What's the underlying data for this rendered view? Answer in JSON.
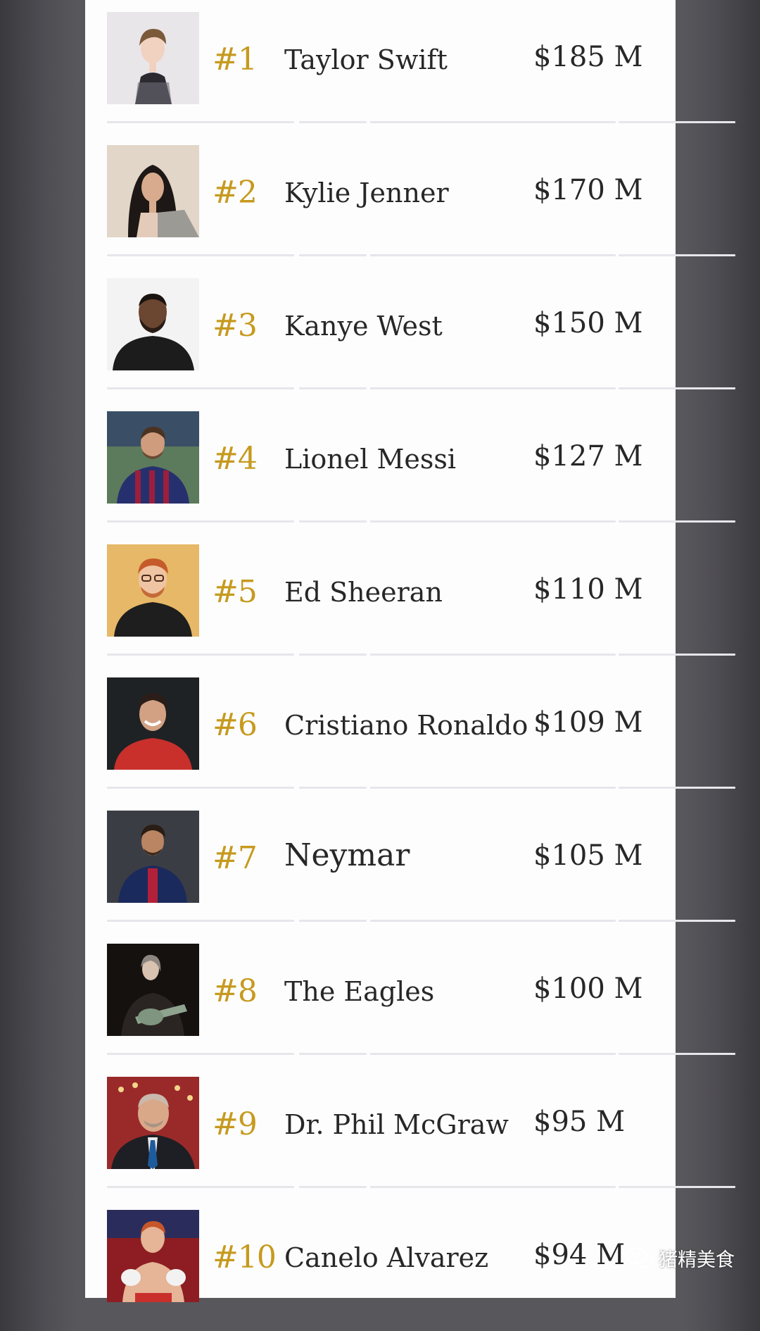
{
  "list": {
    "items": [
      {
        "rank": "#1",
        "name": "Taylor Swift",
        "amount": "$185 M"
      },
      {
        "rank": "#2",
        "name": "Kylie Jenner",
        "amount": "$170 M"
      },
      {
        "rank": "#3",
        "name": "Kanye West",
        "amount": "$150 M"
      },
      {
        "rank": "#4",
        "name": "Lionel Messi",
        "amount": "$127 M"
      },
      {
        "rank": "#5",
        "name": "Ed Sheeran",
        "amount": "$110 M"
      },
      {
        "rank": "#6",
        "name": "Cristiano Ronaldo",
        "amount": "$109 M"
      },
      {
        "rank": "#7",
        "name": "Neymar",
        "amount": "$105 M"
      },
      {
        "rank": "#8",
        "name": "The Eagles",
        "amount": "$100 M"
      },
      {
        "rank": "#9",
        "name": "Dr. Phil McGraw",
        "amount": "$95 M"
      },
      {
        "rank": "#10",
        "name": "Canelo Alvarez",
        "amount": "$94 M"
      }
    ]
  },
  "watermark": {
    "text": "猪精美食",
    "icon": "wechat-icon"
  },
  "colors": {
    "rank": "#c69a1e",
    "text": "#272727",
    "panel": "#fdfdfd",
    "separator": "#e6e6eb"
  }
}
